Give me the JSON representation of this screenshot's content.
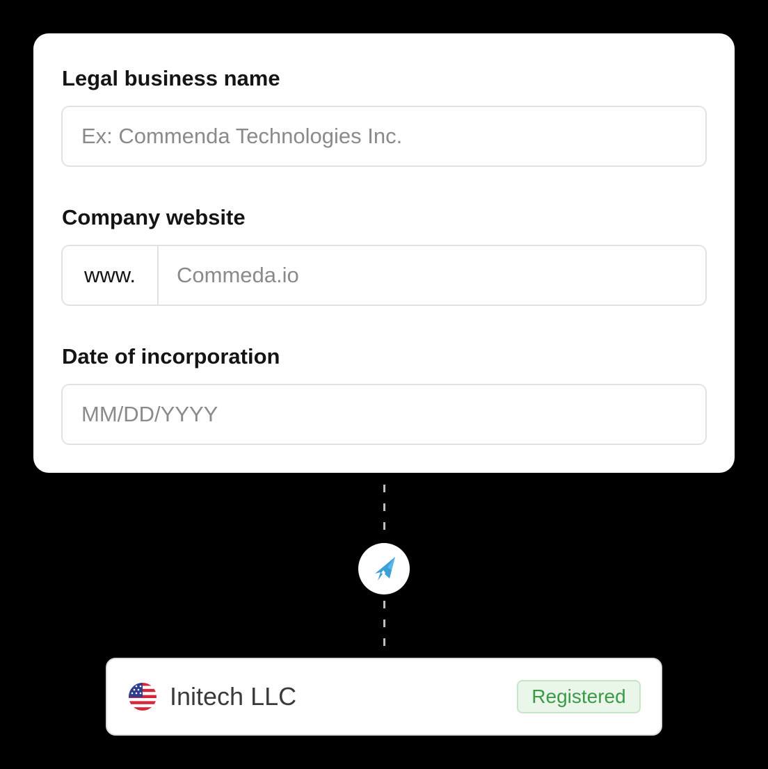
{
  "form": {
    "legal_name": {
      "label": "Legal business name",
      "value": "",
      "placeholder": "Ex: Commenda Technologies Inc."
    },
    "website": {
      "label": "Company website",
      "prefix": "www.",
      "value": "",
      "placeholder": "Commeda.io"
    },
    "incorporation_date": {
      "label": "Date of incorporation",
      "value": "",
      "placeholder": "MM/DD/YYYY"
    }
  },
  "connector": {
    "logo_icon": "commenda-logo-icon",
    "logo_color": "#3b9fd8"
  },
  "result": {
    "flag_icon": "us-flag-icon",
    "company_name": "Initech LLC",
    "status": "Registered",
    "status_color": "#3a9a45"
  }
}
